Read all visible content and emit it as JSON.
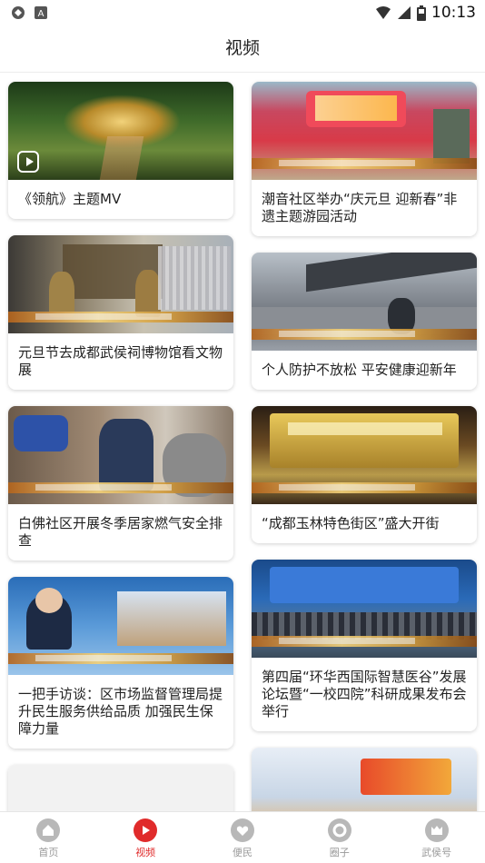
{
  "status_bar": {
    "time": "10:13",
    "left_icons": [
      "sync-icon",
      "a-icon"
    ],
    "right_icons": [
      "wifi-icon",
      "signal-icon",
      "battery-icon"
    ]
  },
  "header": {
    "title": "视频"
  },
  "feed": {
    "left_column": [
      {
        "title": "《领航》主题MV",
        "has_play_icon": true
      },
      {
        "title": "元旦节去成都武侯祠博物馆看文物展"
      },
      {
        "title": "白佛社区开展冬季居家燃气安全排查"
      },
      {
        "title": "一把手访谈：区市场监督管理局提升民生服务供给品质 加强民生保障力量"
      },
      {
        "title": ""
      }
    ],
    "right_column": [
      {
        "title": "潮音社区举办“庆元旦 迎新春”非遗主题游园活动"
      },
      {
        "title": "个人防护不放松 平安健康迎新年"
      },
      {
        "title": "“成都玉林特色街区”盛大开街"
      },
      {
        "title": "第四届“环华西国际智慧医谷”发展论坛暨“一校四院”科研成果发布会举行"
      },
      {
        "title": ""
      }
    ]
  },
  "bottom_nav": [
    {
      "label": "首页",
      "icon": "home-icon",
      "active": false
    },
    {
      "label": "视频",
      "icon": "video-play-icon",
      "active": true
    },
    {
      "label": "便民",
      "icon": "heart-icon",
      "active": false
    },
    {
      "label": "圈子",
      "icon": "circle-icon",
      "active": false
    },
    {
      "label": "武侯号",
      "icon": "crown-icon",
      "active": false
    }
  ],
  "colors": {
    "accent": "#e02b2b",
    "inactive": "#b8b8b8"
  }
}
